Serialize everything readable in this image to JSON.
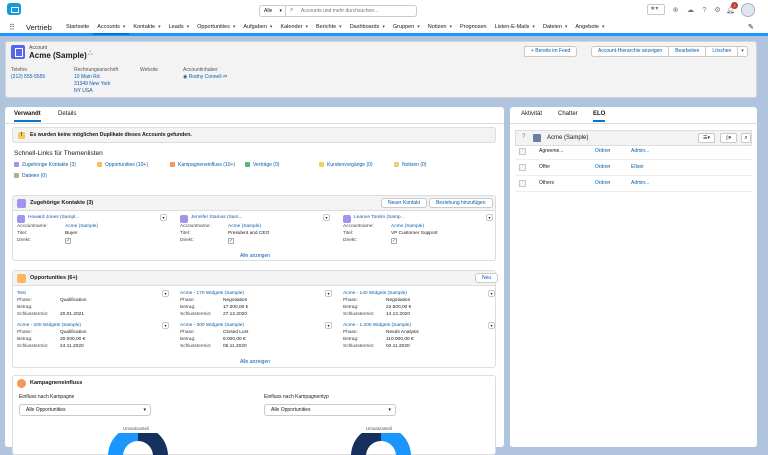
{
  "header": {
    "search_scope": "Alle",
    "search_placeholder": "Accounts und mehr durchsuchen...",
    "notification_count": "2"
  },
  "nav": {
    "app_name": "Vertrieb",
    "items": [
      {
        "label": "Startseite",
        "dropdown": false,
        "active": false
      },
      {
        "label": "Accounts",
        "dropdown": true,
        "active": true
      },
      {
        "label": "Kontakte",
        "dropdown": true,
        "active": false
      },
      {
        "label": "Leads",
        "dropdown": true,
        "active": false
      },
      {
        "label": "Opportunities",
        "dropdown": true,
        "active": false
      },
      {
        "label": "Aufgaben",
        "dropdown": true,
        "active": false
      },
      {
        "label": "Kalender",
        "dropdown": true,
        "active": false
      },
      {
        "label": "Berichte",
        "dropdown": true,
        "active": false
      },
      {
        "label": "Dashboards",
        "dropdown": true,
        "active": false
      },
      {
        "label": "Gruppen",
        "dropdown": true,
        "active": false
      },
      {
        "label": "Notizen",
        "dropdown": true,
        "active": false
      },
      {
        "label": "Prognosen",
        "dropdown": false,
        "active": false
      },
      {
        "label": "Listen-E-Mails",
        "dropdown": true,
        "active": false
      },
      {
        "label": "Dateien",
        "dropdown": true,
        "active": false
      },
      {
        "label": "Angebote",
        "dropdown": true,
        "active": false
      }
    ]
  },
  "record": {
    "type_label": "Account",
    "name": "Acme (Sample)",
    "actions": {
      "follow": "+ Bereits im Feed",
      "hierarchy": "Account-Hierarchie anzeigen",
      "edit": "Bearbeiten",
      "delete": "Löschen"
    },
    "fields": {
      "phone_label": "Telefon",
      "phone": "(212) 555-5555",
      "billing_label": "Rechnungsanschrift",
      "billing_line1": "10 Main Rd.",
      "billing_line2": "31349 New York",
      "billing_line3": "NY USA",
      "website_label": "Website",
      "owner_label": "Accountinhaber",
      "owner": "Rodny Connell"
    }
  },
  "left_tabs": {
    "related": "Verwandt",
    "details": "Details"
  },
  "duplicate_notice": "Es wurden keine möglichen Duplikate dieses Accounts gefunden.",
  "quick_links": {
    "title": "Schnell-Links für Themenlisten",
    "links": [
      {
        "label": "Zugehörige Kontakte (3)",
        "color": "#a094ed"
      },
      {
        "label": "Opportunities (10+)",
        "color": "#fcb95b"
      },
      {
        "label": "Kampagneneinfluss (10+)",
        "color": "#f49756"
      },
      {
        "label": "Verträge (0)",
        "color": "#4bc076"
      },
      {
        "label": "Kundenvorgänge (0)",
        "color": "#f2cf5b"
      },
      {
        "label": "Notizen (0)",
        "color": "#e6d478"
      },
      {
        "label": "Dateien (0)",
        "color": "#baac93"
      }
    ]
  },
  "contacts": {
    "title": "Zugehörige Kontakte (3)",
    "new_btn": "Neuer Kontakt",
    "add_btn": "Beziehung hinzufügen",
    "account_label": "Accountname:",
    "title_label": "Titel:",
    "direct_label": "Direkt:",
    "items": [
      {
        "name": "Howard Jones (Sampl...",
        "account": "Acme (Sample)",
        "title": "Buyer"
      },
      {
        "name": "Jennifer Stamos (Sam...",
        "account": "Acme (Sample)",
        "title": "President and CEO"
      },
      {
        "name": "Leanne Tomlin (Samp...",
        "account": "Acme (Sample)",
        "title": "VP Customer Support"
      }
    ],
    "show_all": "Alle anzeigen"
  },
  "opportunities": {
    "title": "Opportunities (6+)",
    "new_btn": "Neu",
    "phase_label": "Phase:",
    "amount_label": "Betrag:",
    "close_label": "Schlusstermin:",
    "items": [
      {
        "name": "Test",
        "phase": "Qualification",
        "amount": "",
        "close": "20.01.2021"
      },
      {
        "name": "Acme - 170 Widgets (Sample)",
        "phase": "Negotiation",
        "amount": "17.000,00 €",
        "close": "27.12.2020"
      },
      {
        "name": "Acme - 140 Widgets (Sample)",
        "phase": "Negotiation",
        "amount": "22.500,00 €",
        "close": "14.12.2020"
      },
      {
        "name": "Acme - 200 Widgets (Sample)",
        "phase": "Qualification",
        "amount": "20.000,00 €",
        "close": "24.11.2020"
      },
      {
        "name": "Acme - 300 Widgets (Sample)",
        "phase": "Closed Lost",
        "amount": "6.000,00 €",
        "close": "05.11.2020"
      },
      {
        "name": "Acme - 1.200 Widgets (Sample)",
        "phase": "Needs Analysis",
        "amount": "110.000,00 €",
        "close": "02.11.2020"
      }
    ],
    "show_all": "Alle anzeigen"
  },
  "campaign": {
    "title": "Kampagneneinfluss",
    "filter1_label": "Einfluss nach Kampagne",
    "filter1_value": "Alle Opportunities",
    "filter2_label": "Einfluss nach Kampagnentyp",
    "filter2_value": "Alle Opportunities",
    "chart1_caption": "Umsatzanteil",
    "chart2_caption": "Umsatzanteil"
  },
  "right_tabs": {
    "activity": "Aktivität",
    "chatter": "Chatter",
    "elo": "ELO"
  },
  "elo": {
    "title": "Acme (Sample)",
    "rows": [
      {
        "name": "Agreeme...",
        "type": "Ordner",
        "author": "Admin..."
      },
      {
        "name": "Offer",
        "type": "Ordner",
        "author": "ElIser"
      },
      {
        "name": "Others",
        "type": "Ordner",
        "author": "Admin..."
      }
    ]
  },
  "colors": {
    "brand": "#0176d3",
    "link": "#0b5cab",
    "background": "#b0c4df"
  }
}
